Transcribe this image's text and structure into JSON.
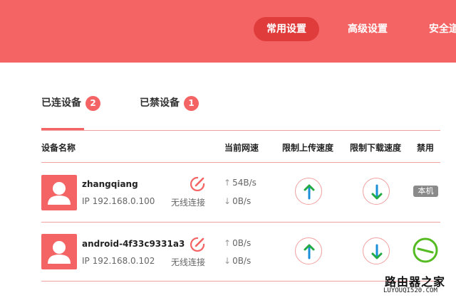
{
  "header": {
    "nav": [
      {
        "label": "常用设置",
        "active": true
      },
      {
        "label": "高级设置",
        "active": false
      },
      {
        "label": "安全道",
        "active": false
      }
    ]
  },
  "tabs": [
    {
      "label": "已连设备",
      "count": "2",
      "active": true
    },
    {
      "label": "已禁设备",
      "count": "1",
      "active": false
    }
  ],
  "table": {
    "columns": [
      "设备名称",
      "当前网速",
      "限制上传速度",
      "限制下载速度",
      "禁用"
    ],
    "rows": [
      {
        "name": "zhangqiang",
        "ip": "IP 192.168.0.100",
        "connection": "无线连接",
        "upload": "54B/s",
        "download": "0B/s",
        "ban": "本机"
      },
      {
        "name": "android-4f33c9331a3",
        "ip": "IP 192.168.0.102",
        "connection": "无线连接",
        "upload": "0B/s",
        "download": "0B/s",
        "ban": ""
      }
    ]
  },
  "watermark": {
    "title": "路由器之家",
    "url": "LUYOUQI520.COM"
  },
  "colors": {
    "accent": "#f56464",
    "accent_dark": "#e03c3c",
    "upload_arrow": "#1a8fd8",
    "download_arrow": "#1a8fd8",
    "ban_green": "#55bb22"
  },
  "icons": {
    "edit": "edit-pen-icon",
    "avatar": "user-avatar-icon",
    "upload": "arrow-up-icon",
    "download": "arrow-down-icon",
    "ban": "minus-circle-icon"
  }
}
